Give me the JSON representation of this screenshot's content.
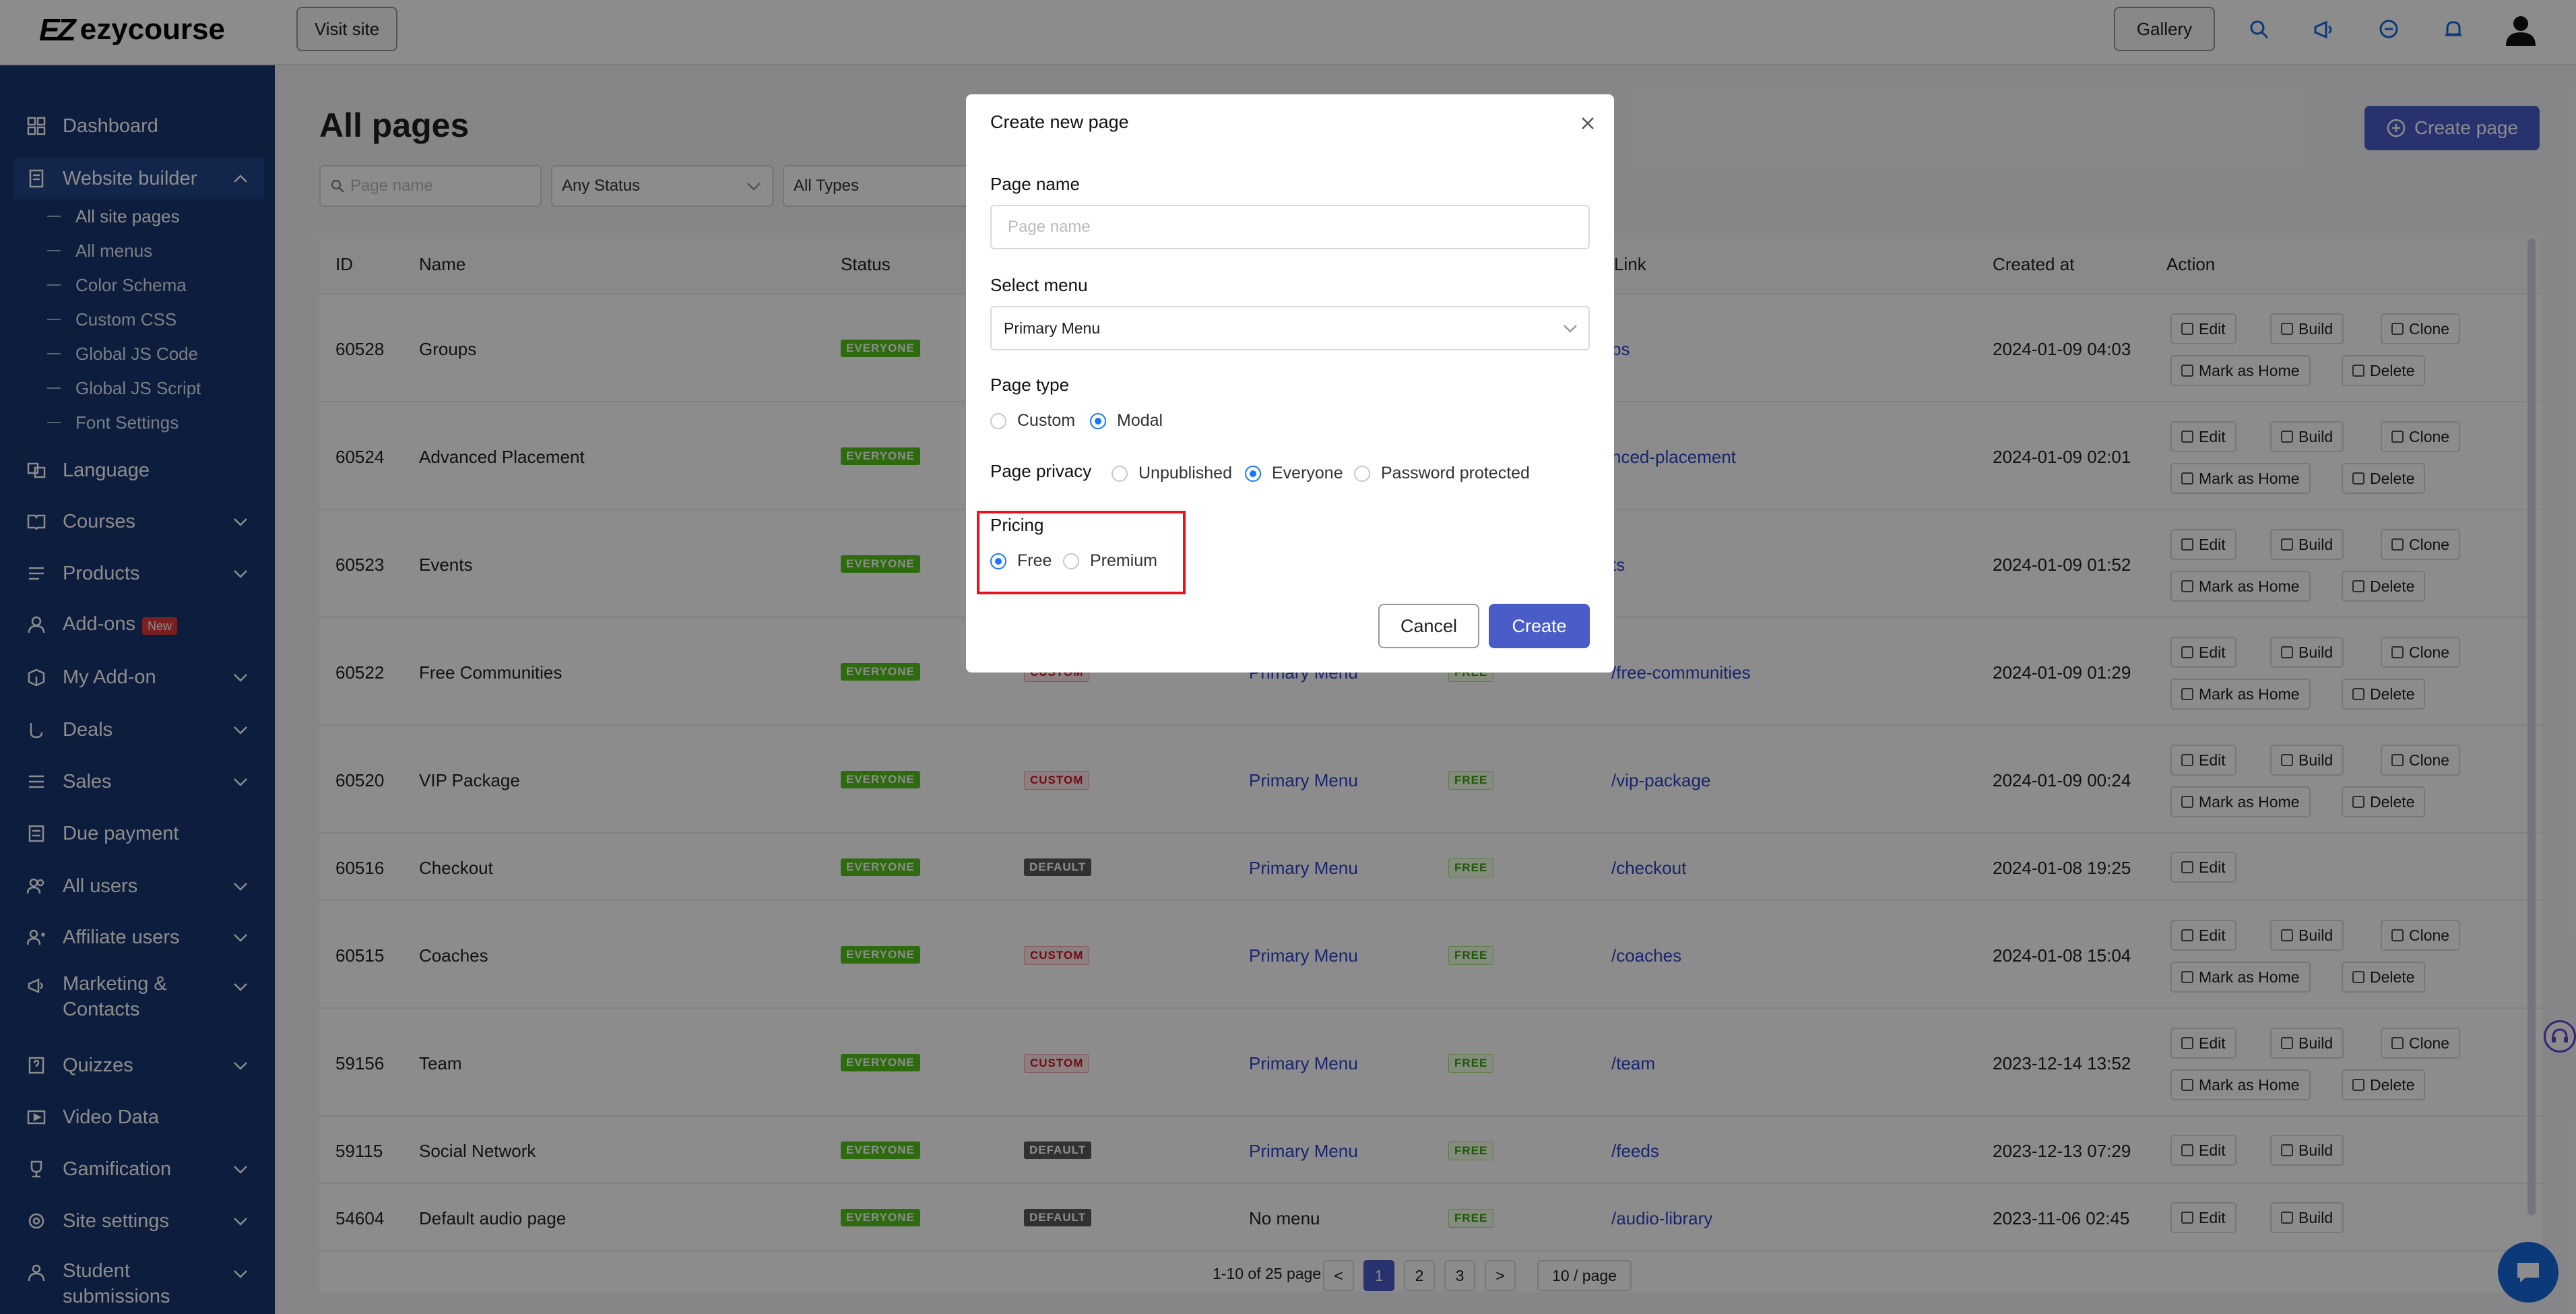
{
  "topbar": {
    "logo_text": "ezycourse",
    "logo_mark": "EZ",
    "visit_site": "Visit site",
    "gallery": "Gallery"
  },
  "sidebar": {
    "items": [
      {
        "label": "Dashboard",
        "icon": "dashboard-grid-icon"
      },
      {
        "label": "Website builder",
        "icon": "page-icon"
      },
      {
        "label": "Language",
        "icon": "language-icon"
      },
      {
        "label": "Courses",
        "icon": "book-icon"
      },
      {
        "label": "Products",
        "icon": "list-icon"
      },
      {
        "label": "Add-ons",
        "icon": "addon-icon",
        "badge": "New"
      },
      {
        "label": "My Add-on",
        "icon": "box-icon"
      },
      {
        "label": "Deals",
        "icon": "deals-icon"
      },
      {
        "label": "Sales",
        "icon": "sales-icon"
      },
      {
        "label": "Due payment",
        "icon": "receipt-icon"
      },
      {
        "label": "All users",
        "icon": "users-icon"
      },
      {
        "label": "Affiliate users",
        "icon": "affiliate-icon"
      },
      {
        "label": "Marketing &",
        "label2": "Contacts",
        "icon": "megaphone-icon"
      },
      {
        "label": "Quizzes",
        "icon": "quiz-icon"
      },
      {
        "label": "Video Data",
        "icon": "video-icon"
      },
      {
        "label": "Gamification",
        "icon": "trophy-icon"
      },
      {
        "label": "Site settings",
        "icon": "settings-icon"
      },
      {
        "label": "Student",
        "label2": "submissions",
        "icon": "submission-icon"
      }
    ],
    "sub_items": [
      "All site pages",
      "All menus",
      "Color Schema",
      "Custom CSS",
      "Global JS Code",
      "Global JS Script",
      "Font Settings"
    ]
  },
  "main": {
    "title": "All pages",
    "create_page": "Create page",
    "filters": {
      "search_placeholder": "Page name",
      "status": "Any Status",
      "types": "All Types"
    },
    "columns": [
      "ID",
      "Name",
      "Status",
      "Link",
      "Created at",
      "Action"
    ],
    "rows": [
      {
        "id": "60528",
        "name": "Groups",
        "status": "EVERYONE",
        "type": "",
        "menu": "",
        "pricing": "",
        "link": "ps",
        "created": "2024-01-09 04:03",
        "actions": "full"
      },
      {
        "id": "60524",
        "name": "Advanced Placement",
        "status": "EVERYONE",
        "type": "",
        "menu": "",
        "pricing": "",
        "link": "nced-placement",
        "created": "2024-01-09 02:01",
        "actions": "full"
      },
      {
        "id": "60523",
        "name": "Events",
        "status": "EVERYONE",
        "type": "",
        "menu": "",
        "pricing": "",
        "link": "ts",
        "created": "2024-01-09 01:52",
        "actions": "full"
      },
      {
        "id": "60522",
        "name": "Free Communities",
        "status": "EVERYONE",
        "type": "CUSTOM",
        "menu": "Primary Menu",
        "pricing": "FREE",
        "link": "/free-communities",
        "created": "2024-01-09 01:29",
        "actions": "full"
      },
      {
        "id": "60520",
        "name": "VIP Package",
        "status": "EVERYONE",
        "type": "CUSTOM",
        "menu": "Primary Menu",
        "pricing": "FREE",
        "link": "/vip-package",
        "created": "2024-01-09 00:24",
        "actions": "full"
      },
      {
        "id": "60516",
        "name": "Checkout",
        "status": "EVERYONE",
        "type": "DEFAULT",
        "menu": "Primary Menu",
        "pricing": "FREE",
        "link": "/checkout",
        "created": "2024-01-08 19:25",
        "actions": "edit"
      },
      {
        "id": "60515",
        "name": "Coaches",
        "status": "EVERYONE",
        "type": "CUSTOM",
        "menu": "Primary Menu",
        "pricing": "FREE",
        "link": "/coaches",
        "created": "2024-01-08 15:04",
        "actions": "full"
      },
      {
        "id": "59156",
        "name": "Team",
        "status": "EVERYONE",
        "type": "CUSTOM",
        "menu": "Primary Menu",
        "pricing": "FREE",
        "link": "/team",
        "created": "2023-12-14 13:52",
        "actions": "full"
      },
      {
        "id": "59115",
        "name": "Social Network",
        "status": "EVERYONE",
        "type": "DEFAULT",
        "menu": "Primary Menu",
        "pricing": "FREE",
        "link": "/feeds",
        "created": "2023-12-13 07:29",
        "actions": "editbuild"
      },
      {
        "id": "54604",
        "name": "Default audio page",
        "status": "EVERYONE",
        "type": "DEFAULT",
        "menu": "No menu",
        "pricing": "FREE",
        "link": "/audio-library",
        "created": "2023-11-06 02:45",
        "actions": "editbuild"
      }
    ],
    "actions": {
      "edit": "Edit",
      "build": "Build",
      "clone": "Clone",
      "home": "Mark as Home",
      "delete": "Delete"
    },
    "pagination": {
      "summary": "1-10 of 25 page",
      "pages": [
        "1",
        "2",
        "3"
      ],
      "prev": "<",
      "next": ">",
      "page_size": "10 / page"
    }
  },
  "modal": {
    "title": "Create new page",
    "page_name_label": "Page name",
    "page_name_placeholder": "Page name",
    "select_menu_label": "Select menu",
    "select_menu_value": "Primary Menu",
    "page_type_label": "Page type",
    "page_type_options": [
      "Custom",
      "Modal"
    ],
    "page_type_selected": "Modal",
    "privacy_label": "Page privacy",
    "privacy_options": [
      "Unpublished",
      "Everyone",
      "Password protected"
    ],
    "privacy_selected": "Everyone",
    "pricing_label": "Pricing",
    "pricing_options": [
      "Free",
      "Premium"
    ],
    "pricing_selected": "Free",
    "cancel": "Cancel",
    "create": "Create"
  },
  "colors": {
    "sidebar": "#17356f",
    "accent": "#4a5cc8",
    "highlight": "#e8141d",
    "radio": "#1677ff"
  }
}
